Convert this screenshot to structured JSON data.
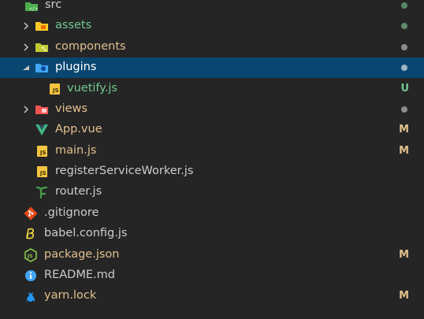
{
  "tree": {
    "src": {
      "label": "src"
    },
    "assets": {
      "label": "assets"
    },
    "components": {
      "label": "components"
    },
    "plugins": {
      "label": "plugins"
    },
    "vuetify": {
      "label": "vuetify.js",
      "status": "U"
    },
    "views": {
      "label": "views"
    },
    "app_vue": {
      "label": "App.vue",
      "status": "M"
    },
    "main_js": {
      "label": "main.js",
      "status": "M"
    },
    "register_sw": {
      "label": "registerServiceWorker.js"
    },
    "router_js": {
      "label": "router.js"
    },
    "gitignore": {
      "label": ".gitignore"
    },
    "babel_config": {
      "label": "babel.config.js"
    },
    "package_json": {
      "label": "package.json",
      "status": "M"
    },
    "readme": {
      "label": "README.md"
    },
    "yarn_lock": {
      "label": "yarn.lock",
      "status": "M"
    }
  },
  "colors": {
    "background": "#252526",
    "selected_row": "#094771",
    "untracked_green": "#73c991",
    "modified_yellow": "#e2c08d",
    "dot_grey": "#8c8c8c"
  }
}
